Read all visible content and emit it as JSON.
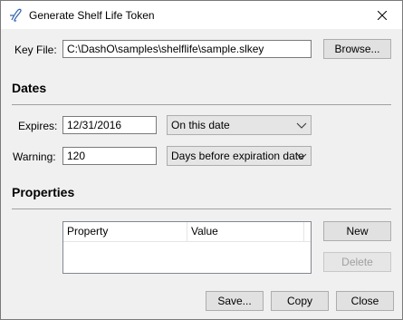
{
  "window": {
    "title": "Generate Shelf Life Token"
  },
  "key_file": {
    "label": "Key File:",
    "value": "C:\\DashO\\samples\\shelflife\\sample.slkey",
    "browse_label": "Browse..."
  },
  "dates": {
    "heading": "Dates",
    "expires_label": "Expires:",
    "expires_value": "12/31/2016",
    "expires_mode": "On this date",
    "warning_label": "Warning:",
    "warning_value": "120",
    "warning_mode": "Days before expiration date"
  },
  "properties": {
    "heading": "Properties",
    "columns": [
      "Property",
      "Value"
    ],
    "rows": [],
    "new_label": "New",
    "delete_label": "Delete"
  },
  "footer": {
    "save_label": "Save...",
    "copy_label": "Copy",
    "close_label": "Close"
  }
}
